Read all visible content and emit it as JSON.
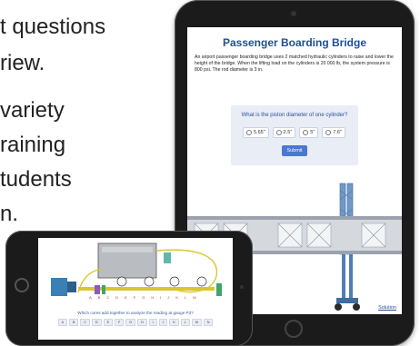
{
  "background_text": {
    "lines": [
      "t questions",
      "riew.",
      "variety",
      "raining",
      "tudents",
      "n."
    ]
  },
  "tablet": {
    "title": "Passenger Boarding Bridge",
    "description": "An airport passenger boarding bridge uses 2 matched hydraulic cylinders to raise and lower the height of the bridge. When the lifting load on the cylinders is 20 000 lb, the system pressure is 800 psi. The rod diameter is 3 in.",
    "question": "What is the piston diameter of one cylinder?",
    "options": [
      "5.65\"",
      "2.5\"",
      "5\"",
      "7.6\""
    ],
    "submit_label": "Submit",
    "solution_label": "Solution"
  },
  "phone": {
    "circuit_letters": [
      "A",
      "B",
      "C",
      "D",
      "E",
      "F",
      "G",
      "H",
      "I",
      "J",
      "K",
      "L",
      "M"
    ],
    "question": "Which cores add together to analyze the reading at gauge P3?",
    "choices": [
      "A",
      "B",
      "C",
      "D",
      "E",
      "F",
      "G",
      "H",
      "I",
      "J",
      "K",
      "L",
      "M",
      "N"
    ]
  },
  "colors": {
    "title_blue": "#1f4e9c",
    "button_blue": "#4a77d1",
    "card_bg": "#e9edf6",
    "device_body": "#1b1b1b"
  }
}
